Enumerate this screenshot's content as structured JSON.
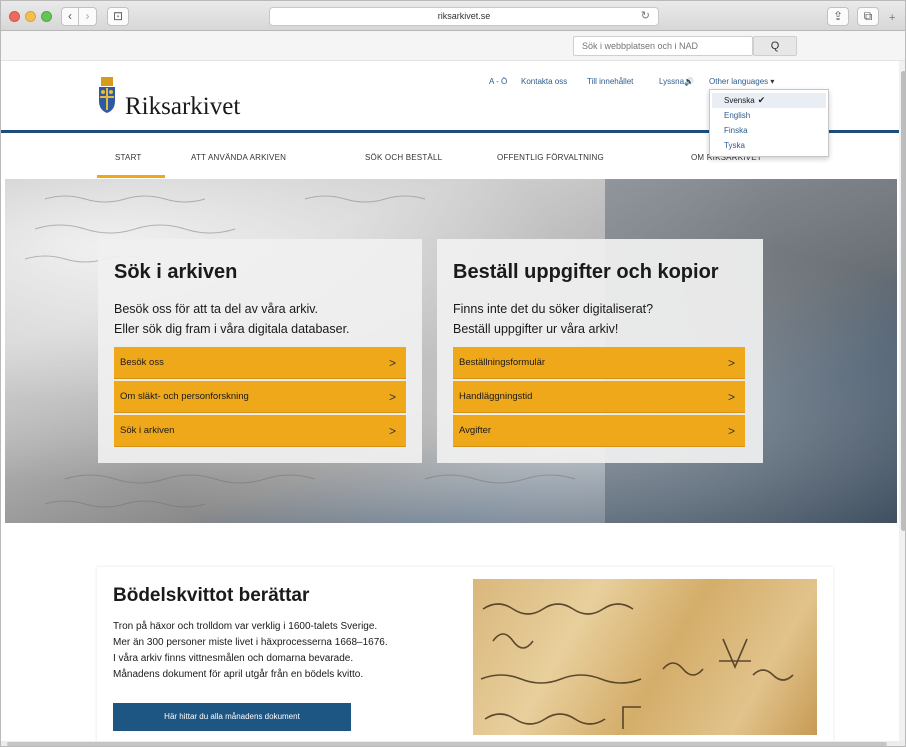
{
  "browser": {
    "url": "riksarkivet.se",
    "back_glyph": "‹",
    "forward_glyph": "›",
    "sidebar_glyph": "⊡",
    "reload_glyph": "↻",
    "share_glyph": "⇪",
    "tabs_glyph": "⧉",
    "plus_glyph": "+"
  },
  "search": {
    "placeholder": "Sök i webbplatsen och i NAD",
    "button_icon": "Q"
  },
  "site": {
    "name": "Riksarkivet",
    "crest_icon": "crest-icon"
  },
  "toplinks": {
    "a_o": "A - Ö",
    "contact": "Kontakta oss",
    "to_content": "Till innehållet",
    "listen": "Lyssna",
    "listen_icon": "🔊",
    "other_languages": "Other languages",
    "caret": "▾"
  },
  "language_dropdown": {
    "items": [
      {
        "label": "Svenska",
        "selected": true
      },
      {
        "label": "English",
        "selected": false
      },
      {
        "label": "Finska",
        "selected": false
      },
      {
        "label": "Tyska",
        "selected": false
      }
    ],
    "check_glyph": "✔"
  },
  "mainnav": {
    "items": [
      {
        "label": "START",
        "active": true
      },
      {
        "label": "ATT ANVÄNDA ARKIVEN",
        "active": false
      },
      {
        "label": "SÖK OCH BESTÄLL",
        "active": false
      },
      {
        "label": "OFFENTLIG FÖRVALTNING",
        "active": false
      },
      {
        "label": "OM RIKSARKIVET",
        "active": false
      }
    ]
  },
  "hero": {
    "left": {
      "title": "Sök i arkiven",
      "text_line1": "Besök oss för att ta del av våra arkiv.",
      "text_line2": "Eller sök dig fram i våra digitala databaser.",
      "buttons": [
        "Besök oss",
        "Om släkt- och personforskning",
        "Sök i arkiven"
      ]
    },
    "right": {
      "title": "Beställ uppgifter och kopior",
      "text_line1": "Finns inte det du söker digitaliserat?",
      "text_line2": "Beställ uppgifter ur våra arkiv!",
      "buttons": [
        "Beställningsformulär",
        "Handläggningstid",
        "Avgifter"
      ]
    },
    "chevron": ">"
  },
  "feature": {
    "title": "Bödelskvittot berättar",
    "lines": [
      "Tron på häxor och trolldom var verklig i 1600-talets Sverige.",
      "Mer än 300 personer miste livet i häxprocesserna 1668–1676.",
      "I våra arkiv finns vittnesmålen och domarna bevarade.",
      "Månadens dokument för april utgår från en bödels kvitto."
    ],
    "button": "Här hittar du alla månadens dokument"
  },
  "colors": {
    "accent_orange": "#f0a81b",
    "brand_blue": "#1c4e7c",
    "button_blue": "#1d5583"
  }
}
